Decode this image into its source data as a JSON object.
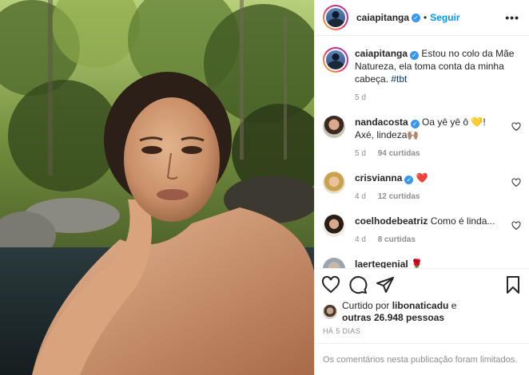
{
  "header": {
    "username": "caiapitanga",
    "separator": "•",
    "follow_label": "Seguir",
    "more_label": "•••"
  },
  "caption": {
    "username": "caiapitanga",
    "text": "Estou no colo da Mãe Natureza, ela toma conta da minha cabeça.",
    "hashtag": "#tbt",
    "time": "5 d"
  },
  "comments": [
    {
      "username": "nandacosta",
      "text": "Oa yê yê ô 💛! Axé, lindeza🙌🏽",
      "time": "5 d",
      "likes": "94 curtidas",
      "verified": true
    },
    {
      "username": "crisvianna",
      "text": "❤️",
      "time": "4 d",
      "likes": "12 curtidas",
      "verified": true
    },
    {
      "username": "coelhodebeatriz",
      "text": "Como é linda...",
      "time": "4 d",
      "likes": "8 curtidas",
      "verified": false
    },
    {
      "username": "laertegenial",
      "text": "🌹",
      "time": "",
      "likes": "",
      "verified": false
    }
  ],
  "likes": {
    "prefix": "Curtido por",
    "user": "libonaticadu",
    "connector": "e",
    "others": "outras 26.948 pessoas"
  },
  "timestamp": "HÁ 5 DIAS",
  "limited_text": "Os comentários nesta publicação foram limitados.",
  "colors": {
    "link": "#0095f6",
    "verified": "#3897f0",
    "muted": "#8e8e8e"
  }
}
